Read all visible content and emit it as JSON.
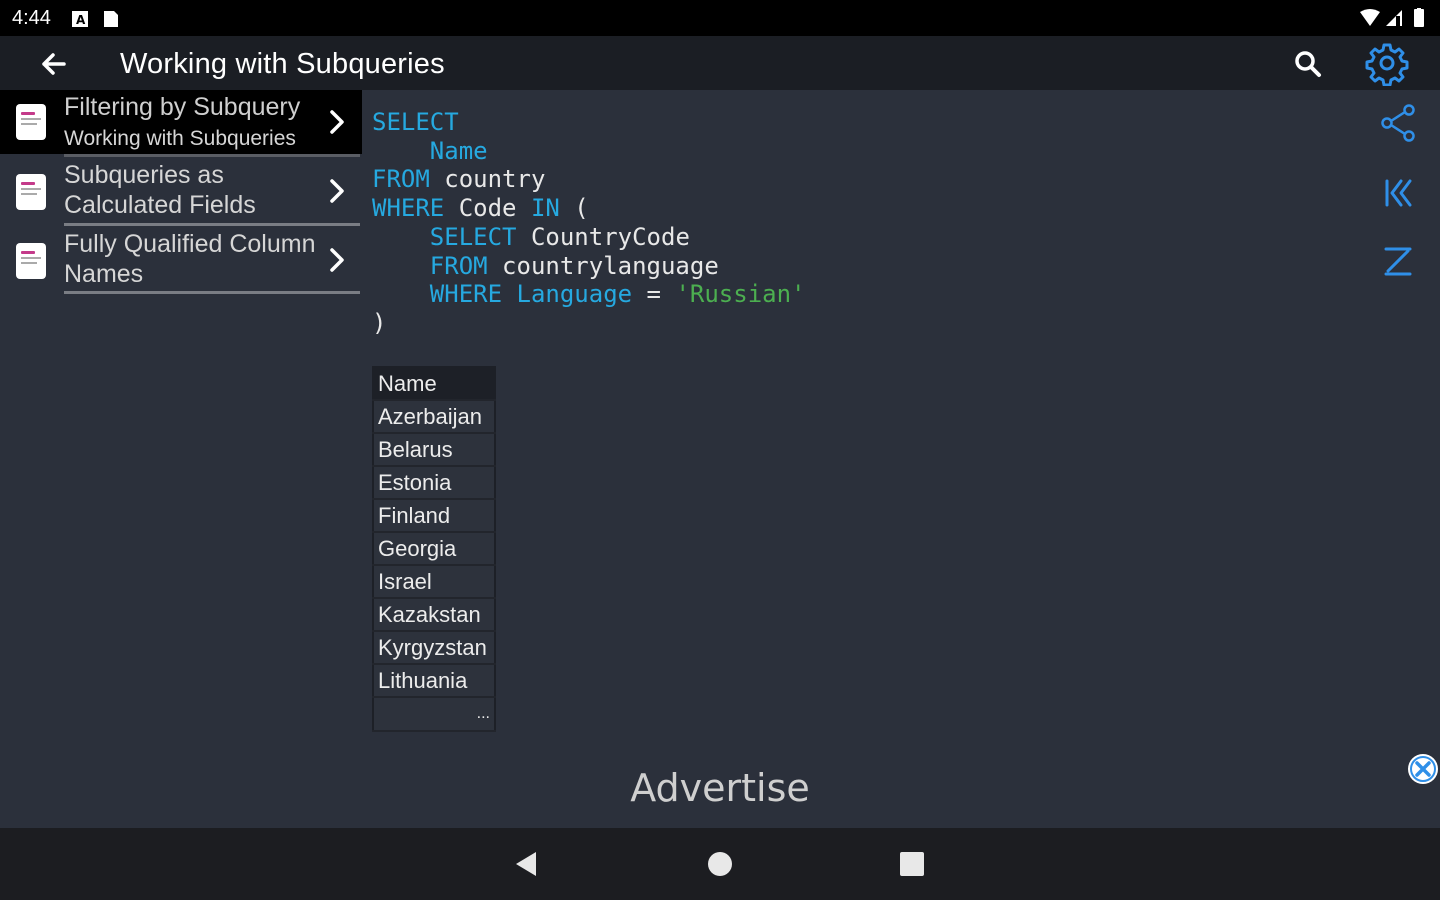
{
  "status_bar": {
    "time": "4:44"
  },
  "app_bar": {
    "title": "Working with Subqueries"
  },
  "sidebar": {
    "items": [
      {
        "title": "Filtering by Subquery",
        "subtitle": "Working with Subqueries",
        "active": true
      },
      {
        "title": "Subqueries as Calculated Fields",
        "subtitle": "",
        "active": false
      },
      {
        "title": "Fully Qualified Column Names",
        "subtitle": "",
        "active": false
      }
    ]
  },
  "code": {
    "lines": [
      [
        {
          "t": "SELECT",
          "c": "kw"
        }
      ],
      [
        {
          "t": "    ",
          "c": "txt"
        },
        {
          "t": "Name",
          "c": "kw"
        }
      ],
      [
        {
          "t": "FROM",
          "c": "kw"
        },
        {
          "t": " country",
          "c": "txt"
        }
      ],
      [
        {
          "t": "WHERE",
          "c": "kw"
        },
        {
          "t": " Code ",
          "c": "txt"
        },
        {
          "t": "IN",
          "c": "kw"
        },
        {
          "t": " (",
          "c": "txt"
        }
      ],
      [
        {
          "t": "    ",
          "c": "txt"
        },
        {
          "t": "SELECT",
          "c": "kw"
        },
        {
          "t": " CountryCode",
          "c": "txt"
        }
      ],
      [
        {
          "t": "    ",
          "c": "txt"
        },
        {
          "t": "FROM",
          "c": "kw"
        },
        {
          "t": " countrylanguage",
          "c": "txt"
        }
      ],
      [
        {
          "t": "    ",
          "c": "txt"
        },
        {
          "t": "WHERE",
          "c": "kw"
        },
        {
          "t": " ",
          "c": "txt"
        },
        {
          "t": "Language",
          "c": "kw"
        },
        {
          "t": " = ",
          "c": "txt"
        },
        {
          "t": "'Russian'",
          "c": "str"
        }
      ],
      [
        {
          "t": ")",
          "c": "txt"
        }
      ]
    ]
  },
  "result": {
    "columns": [
      "Name"
    ],
    "rows": [
      "Azerbaijan",
      "Belarus",
      "Estonia",
      "Finland",
      "Georgia",
      "Israel",
      "Kazakstan",
      "Kyrgyzstan",
      "Lithuania"
    ],
    "more": "..."
  },
  "ad": {
    "label": "Advertise"
  },
  "colors": {
    "keyword": "#26a9e0",
    "string": "#4caf50",
    "background": "#2b303b",
    "app_bar": "#1b1e24"
  },
  "icons": {
    "back": "arrow-left-icon",
    "search": "search-icon",
    "settings": "gear-icon",
    "share": "share-icon",
    "first": "first-page-icon",
    "last": "last-page-icon",
    "close": "close-icon"
  }
}
